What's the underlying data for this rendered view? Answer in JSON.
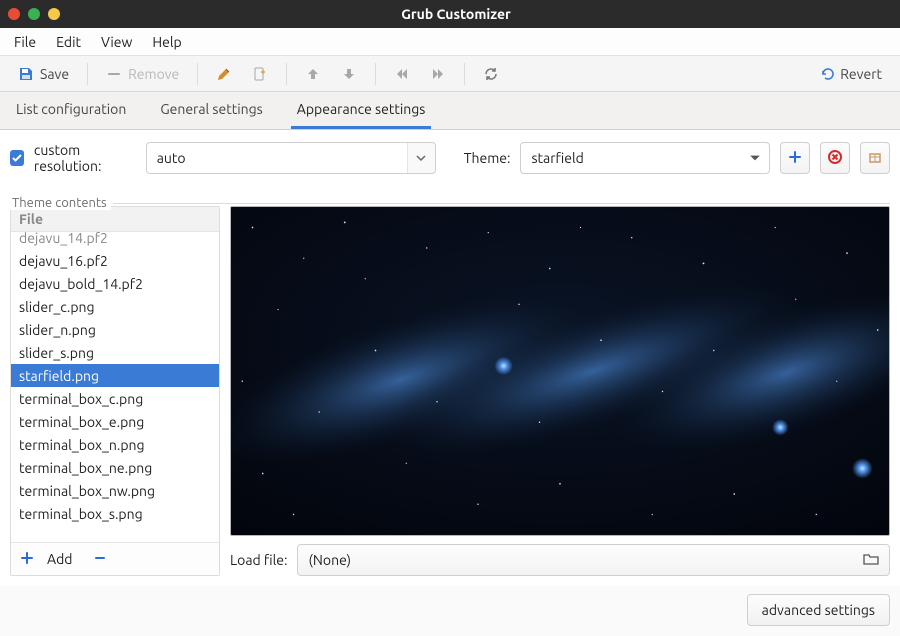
{
  "window": {
    "title": "Grub Customizer"
  },
  "menubar": {
    "file": "File",
    "edit": "Edit",
    "view": "View",
    "help": "Help"
  },
  "toolbar": {
    "save": "Save",
    "remove": "Remove",
    "revert": "Revert"
  },
  "tabs": {
    "list": "List configuration",
    "general": "General settings",
    "appearance": "Appearance settings",
    "active": "appearance"
  },
  "resolution": {
    "checkbox_label": "custom resolution:",
    "value": "auto"
  },
  "theme": {
    "label": "Theme:",
    "selected": "starfield"
  },
  "theme_contents": {
    "group_label": "Theme contents",
    "file_header": "File",
    "files_cut_top": "dejavu_14.pf2",
    "files": [
      "dejavu_16.pf2",
      "dejavu_bold_14.pf2",
      "slider_c.png",
      "slider_n.png",
      "slider_s.png",
      "starfield.png",
      "terminal_box_c.png",
      "terminal_box_e.png",
      "terminal_box_n.png",
      "terminal_box_ne.png",
      "terminal_box_nw.png",
      "terminal_box_s.png"
    ],
    "selected": "starfield.png",
    "add_label": "Add",
    "load_label": "Load file:",
    "file_chooser_value": "(None)"
  },
  "footer": {
    "advanced": "advanced settings"
  }
}
